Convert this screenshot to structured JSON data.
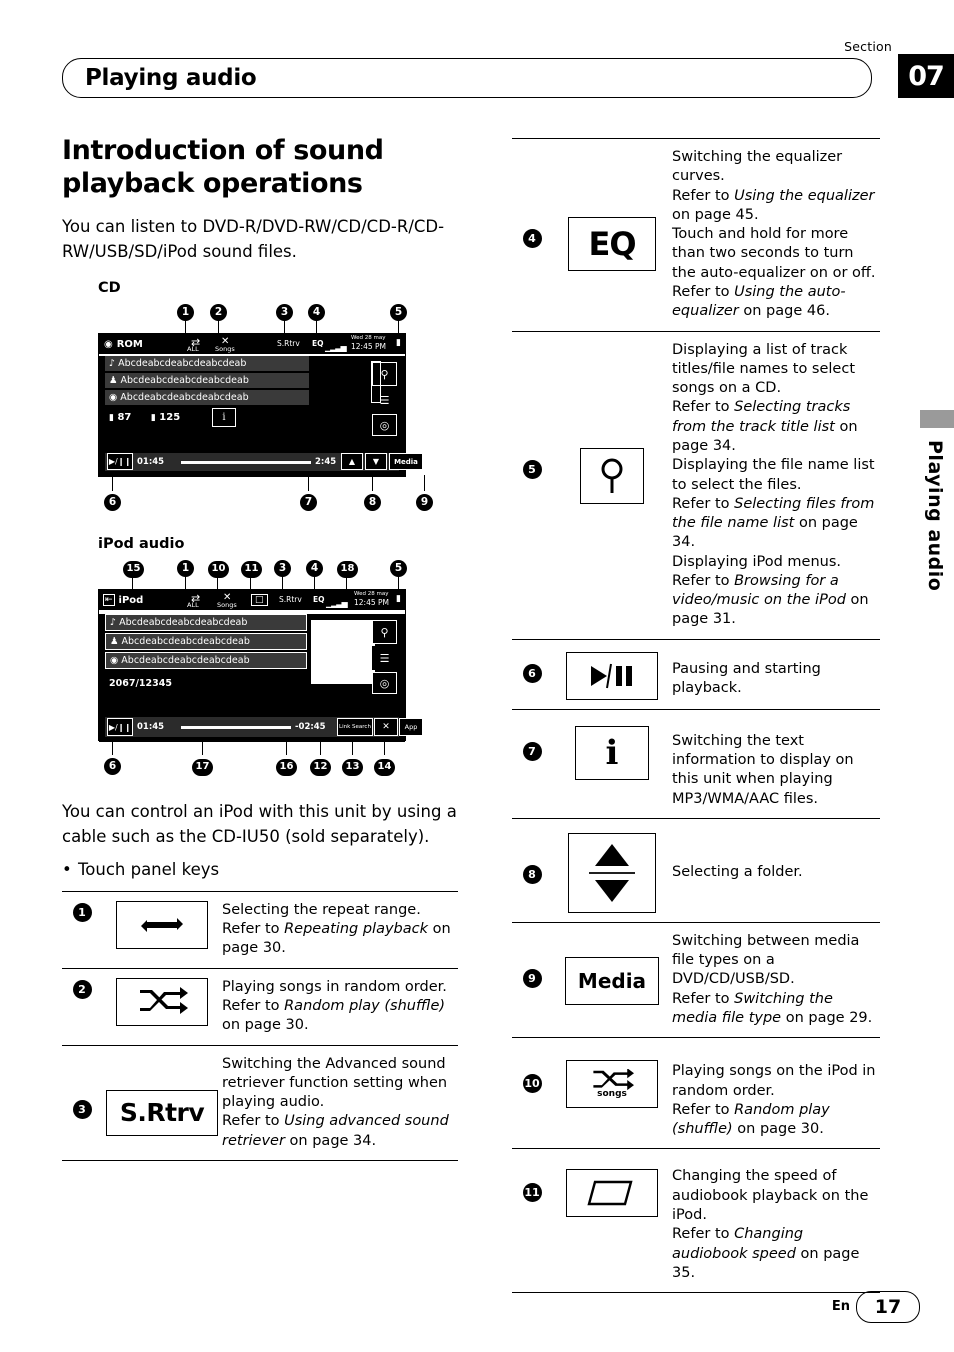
{
  "header": {
    "section_word": "Section",
    "section_number": "07",
    "chapter_title": "Playing audio",
    "side_tab_text": "Playing audio"
  },
  "left": {
    "heading": "Introduction of sound playback operations",
    "intro": "You can listen to DVD-R/DVD-RW/CD/CD-R/CD-RW/USB/SD/iPod sound files.",
    "cd_label": "CD",
    "ipod_label": "iPod audio",
    "body_text": "You can control an iPod with this unit by using a cable such as the CD-IU50 (sold separately).",
    "bullet_text": "Touch panel keys"
  },
  "cd_screen": {
    "source_label": "ROM",
    "all_label": "ALL",
    "songs_label": "Songs",
    "srtrv_label": "S.Rtrv",
    "eq_label": "EQ",
    "clock_date": "Wed 28 may",
    "clock_time": "12:45 PM",
    "track1": "Abcdeabcdeabcdeabcdeab",
    "track2": "Abcdeabcdeabcdeabcdeab",
    "track3": "Abcdeabcdeabcdeabcdeab",
    "folder_num": "87",
    "track_num": "125",
    "time_elapsed": "01:45",
    "time_total": "2:45",
    "media_label": "Media",
    "callouts": [
      "1",
      "2",
      "3",
      "4",
      "5",
      "6",
      "7",
      "8",
      "9"
    ]
  },
  "ipod_screen": {
    "source_label": "iPod",
    "all_label": "ALL",
    "songs_label": "Songs",
    "srtrv_label": "S.Rtrv",
    "eq_label": "EQ",
    "clock_date": "Wed 28 may",
    "clock_time": "12:45 PM",
    "track1": "Abcdeabcdeabcdeabcdeab",
    "track2": "Abcdeabcdeabcdeabcdeab",
    "track3": "Abcdeabcdeabcdeabcdeab",
    "counter": "2067/12345",
    "time_elapsed": "01:45",
    "time_remaining": "-02:45",
    "link_search": "Link Search",
    "app_label": "App",
    "callouts": [
      "15",
      "1",
      "10",
      "11",
      "3",
      "4",
      "18",
      "5",
      "6",
      "17",
      "16",
      "12",
      "13",
      "14"
    ]
  },
  "left_table": [
    {
      "num": "1",
      "icon": "repeat-icon",
      "lines": [
        {
          "t": "Selecting the repeat range.",
          "i": false
        },
        {
          "t": "Refer to ",
          "i": false
        },
        {
          "t": "Repeating playback",
          "i": true
        },
        {
          "t": " on page 30.",
          "i": false
        }
      ]
    },
    {
      "num": "2",
      "icon": "shuffle-icon",
      "lines": [
        {
          "t": "Playing songs in random order.",
          "i": false
        },
        {
          "t": "Refer to ",
          "i": false
        },
        {
          "t": "Random play (shuffle)",
          "i": true
        },
        {
          "t": " on page 30.",
          "i": false
        }
      ]
    },
    {
      "num": "3",
      "icon": "s-rtrv-key",
      "label": "S.Rtrv",
      "lines": [
        {
          "t": "Switching the Advanced sound retriever function setting when playing audio.",
          "i": false
        },
        {
          "t": "Refer to ",
          "i": false
        },
        {
          "t": "Using advanced sound retriever",
          "i": true
        },
        {
          "t": " on page 34.",
          "i": false
        }
      ]
    }
  ],
  "right_table": [
    {
      "num": "4",
      "icon": "eq-key",
      "label": "EQ",
      "lines": [
        {
          "t": "Switching the equalizer curves.",
          "i": false
        },
        {
          "t": "Refer to ",
          "i": false
        },
        {
          "t": "Using the equalizer",
          "i": true
        },
        {
          "t": " on page 45.",
          "i": false
        },
        {
          "t": "Touch and hold for more than two seconds to turn the auto-equalizer on or off.",
          "i": false
        },
        {
          "t": "Refer to ",
          "i": false
        },
        {
          "t": "Using the auto-equalizer",
          "i": true
        },
        {
          "t": " on page 46.",
          "i": false
        }
      ]
    },
    {
      "num": "5",
      "icon": "list-search-icon",
      "lines": [
        {
          "t": "Displaying a list of track titles/file names to select songs on a CD.",
          "i": false
        },
        {
          "t": "Refer to ",
          "i": false
        },
        {
          "t": "Selecting tracks from the track title list",
          "i": true
        },
        {
          "t": " on page 34.",
          "i": false
        },
        {
          "t": "Displaying the file name list to select the files.",
          "i": false
        },
        {
          "t": "Refer to ",
          "i": false
        },
        {
          "t": "Selecting files from the file name list",
          "i": true
        },
        {
          "t": " on page 34.",
          "i": false
        },
        {
          "t": "Displaying iPod menus.",
          "i": false
        },
        {
          "t": "Refer to ",
          "i": false
        },
        {
          "t": "Browsing for a video/music on the iPod",
          "i": true
        },
        {
          "t": " on page 31.",
          "i": false
        }
      ]
    },
    {
      "num": "6",
      "icon": "play-pause-key",
      "lines": [
        {
          "t": "Pausing and starting playback.",
          "i": false
        }
      ]
    },
    {
      "num": "7",
      "icon": "info-key",
      "label": "i",
      "lines": [
        {
          "t": "Switching the text information to display on this unit when playing MP3/WMA/AAC files.",
          "i": false
        }
      ]
    },
    {
      "num": "8",
      "icon": "up-down-arrows-key",
      "lines": [
        {
          "t": "Selecting a folder.",
          "i": false
        }
      ]
    },
    {
      "num": "9",
      "icon": "media-key",
      "label": "Media",
      "lines": [
        {
          "t": "Switching between media file types on a DVD/CD/USB/SD.",
          "i": false
        },
        {
          "t": "Refer to ",
          "i": false
        },
        {
          "t": "Switching the media file type",
          "i": true
        },
        {
          "t": " on page 29.",
          "i": false
        }
      ]
    },
    {
      "num": "10",
      "icon": "shuffle-songs-key",
      "label": "songs",
      "lines": [
        {
          "t": "Playing songs on the iPod in random order.",
          "i": false
        },
        {
          "t": "Refer to ",
          "i": false
        },
        {
          "t": "Random play (shuffle)",
          "i": true
        },
        {
          "t": " on page 30.",
          "i": false
        }
      ]
    },
    {
      "num": "11",
      "icon": "audiobook-speed-key",
      "lines": [
        {
          "t": "Changing the speed of audiobook playback on the iPod.",
          "i": false
        },
        {
          "t": "Refer to ",
          "i": false
        },
        {
          "t": "Changing audiobook speed",
          "i": true
        },
        {
          "t": " on page 35.",
          "i": false
        }
      ]
    }
  ],
  "footer": {
    "lang": "En",
    "page": "17"
  }
}
